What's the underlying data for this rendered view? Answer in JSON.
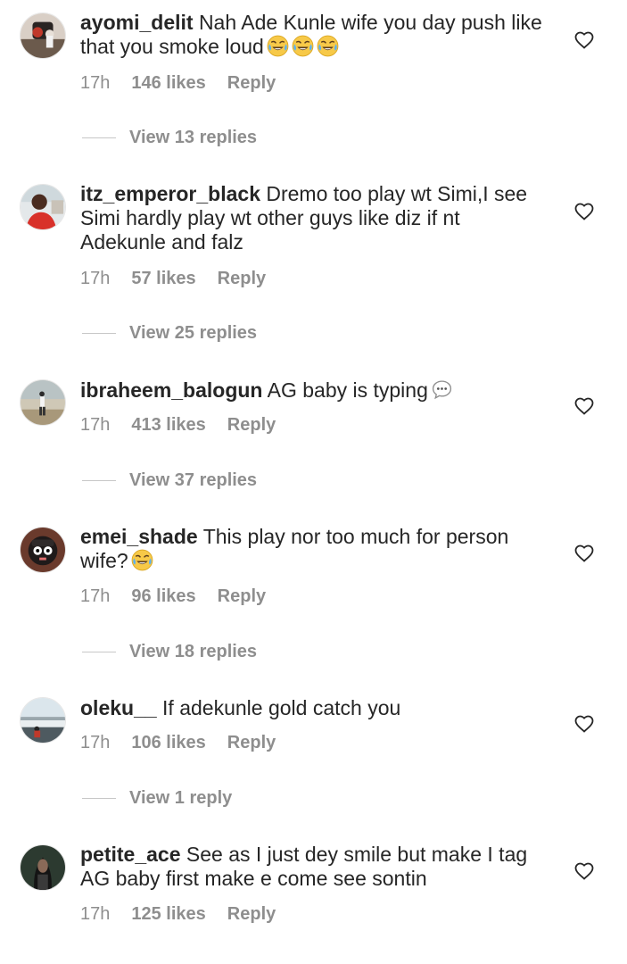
{
  "comments": [
    {
      "username": "ayomi_delit",
      "text": "Nah Ade Kunle wife you day push like that you smoke loud",
      "emojis": [
        "face-with-tears-of-joy",
        "face-with-tears-of-joy",
        "face-with-tears-of-joy"
      ],
      "time": "17h",
      "likes": "146 likes",
      "reply": "Reply",
      "view_replies": "View 13 replies"
    },
    {
      "username": "itz_emperor_black",
      "text": "Dremo too play wt Simi,I see Simi hardly play wt other guys like diz if nt Adekunle and falz",
      "emojis": [],
      "time": "17h",
      "likes": "57 likes",
      "reply": "Reply",
      "view_replies": "View 25 replies"
    },
    {
      "username": "ibraheem_balogun",
      "text": "AG baby is typing",
      "emojis": [
        "speech-balloon-typing"
      ],
      "time": "17h",
      "likes": "413 likes",
      "reply": "Reply",
      "view_replies": "View 37 replies"
    },
    {
      "username": "emei_shade",
      "text": "This play nor too much for person wife?",
      "emojis": [
        "face-with-tears-of-joy"
      ],
      "time": "17h",
      "likes": "96 likes",
      "reply": "Reply",
      "view_replies": "View 18 replies"
    },
    {
      "username": "oleku__",
      "text": "If adekunle gold catch you",
      "emojis": [],
      "time": "17h",
      "likes": "106 likes",
      "reply": "Reply",
      "view_replies": "View 1 reply"
    },
    {
      "username": "petite_ace",
      "text": "See as I just dey smile but make I tag AG baby first make e come see sontin",
      "emojis": [],
      "time": "17h",
      "likes": "125 likes",
      "reply": "Reply",
      "view_replies": ""
    }
  ],
  "colors": {
    "text": "#262626",
    "secondary": "#8e8e8e",
    "background": "#ffffff"
  },
  "icons": {
    "like": "heart-outline-icon"
  }
}
